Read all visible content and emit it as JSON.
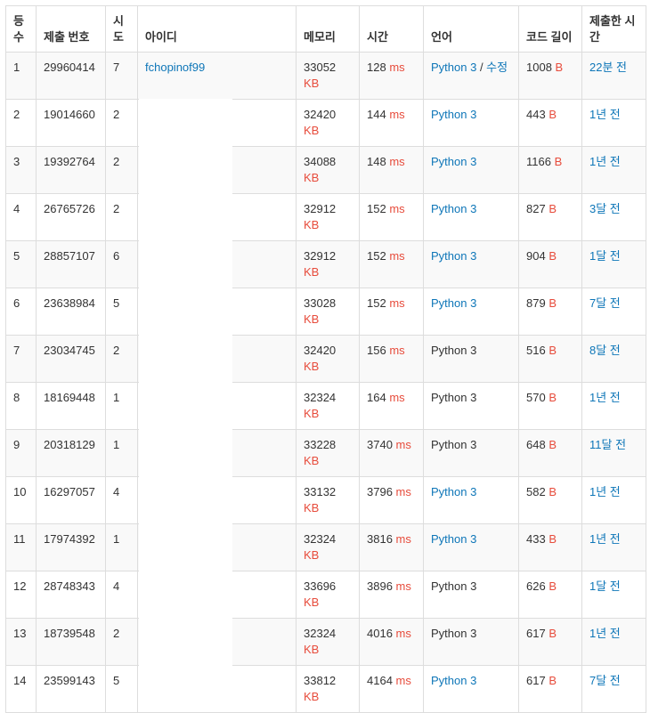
{
  "headers": {
    "rank": "등\n수",
    "submission_id": "제출 번호",
    "attempts": "시\n도",
    "user_id": "아이디",
    "memory": "메모리",
    "time": "시간",
    "language": "언어",
    "code_length": "코드 길이",
    "submitted_at": "제출한 시\n간"
  },
  "units": {
    "kb": "KB",
    "ms": "ms",
    "bytes": "B"
  },
  "edit_separator": " / ",
  "edit_label": "수정",
  "rows": [
    {
      "rank": "1",
      "id": "29960414",
      "tries": "7",
      "user": "fchopinof99",
      "mem": "33052",
      "time": "128",
      "lang": "Python 3",
      "lang_link": true,
      "edit": true,
      "len": "1008",
      "when": "22분 전"
    },
    {
      "rank": "2",
      "id": "19014660",
      "tries": "2",
      "user": "",
      "mem": "32420",
      "time": "144",
      "lang": "Python 3",
      "lang_link": true,
      "edit": false,
      "len": "443",
      "when": "1년 전"
    },
    {
      "rank": "3",
      "id": "19392764",
      "tries": "2",
      "user": "",
      "mem": "34088",
      "time": "148",
      "lang": "Python 3",
      "lang_link": true,
      "edit": false,
      "len": "1166",
      "when": "1년 전"
    },
    {
      "rank": "4",
      "id": "26765726",
      "tries": "2",
      "user": "",
      "mem": "32912",
      "time": "152",
      "lang": "Python 3",
      "lang_link": true,
      "edit": false,
      "len": "827",
      "when": "3달 전"
    },
    {
      "rank": "5",
      "id": "28857107",
      "tries": "6",
      "user": "",
      "mem": "32912",
      "time": "152",
      "lang": "Python 3",
      "lang_link": true,
      "edit": false,
      "len": "904",
      "when": "1달 전"
    },
    {
      "rank": "6",
      "id": "23638984",
      "tries": "5",
      "user": "",
      "mem": "33028",
      "time": "152",
      "lang": "Python 3",
      "lang_link": true,
      "edit": false,
      "len": "879",
      "when": "7달 전"
    },
    {
      "rank": "7",
      "id": "23034745",
      "tries": "2",
      "user": "",
      "mem": "32420",
      "time": "156",
      "lang": "Python 3",
      "lang_link": false,
      "edit": false,
      "len": "516",
      "when": "8달 전"
    },
    {
      "rank": "8",
      "id": "18169448",
      "tries": "1",
      "user": "",
      "mem": "32324",
      "time": "164",
      "lang": "Python 3",
      "lang_link": false,
      "edit": false,
      "len": "570",
      "when": "1년 전"
    },
    {
      "rank": "9",
      "id": "20318129",
      "tries": "1",
      "user": "",
      "mem": "33228",
      "time": "3740",
      "lang": "Python 3",
      "lang_link": false,
      "edit": false,
      "len": "648",
      "when": "11달 전"
    },
    {
      "rank": "10",
      "id": "16297057",
      "tries": "4",
      "user": "",
      "mem": "33132",
      "time": "3796",
      "lang": "Python 3",
      "lang_link": true,
      "edit": false,
      "len": "582",
      "when": "1년 전"
    },
    {
      "rank": "11",
      "id": "17974392",
      "tries": "1",
      "user": "",
      "mem": "32324",
      "time": "3816",
      "lang": "Python 3",
      "lang_link": true,
      "edit": false,
      "len": "433",
      "when": "1년 전"
    },
    {
      "rank": "12",
      "id": "28748343",
      "tries": "4",
      "user": "",
      "mem": "33696",
      "time": "3896",
      "lang": "Python 3",
      "lang_link": false,
      "edit": false,
      "len": "626",
      "when": "1달 전"
    },
    {
      "rank": "13",
      "id": "18739548",
      "tries": "2",
      "user": "",
      "mem": "32324",
      "time": "4016",
      "lang": "Python 3",
      "lang_link": false,
      "edit": false,
      "len": "617",
      "when": "1년 전"
    },
    {
      "rank": "14",
      "id": "23599143",
      "tries": "5",
      "user": "",
      "mem": "33812",
      "time": "4164",
      "lang": "Python 3",
      "lang_link": true,
      "edit": false,
      "len": "617",
      "when": "7달 전"
    }
  ]
}
